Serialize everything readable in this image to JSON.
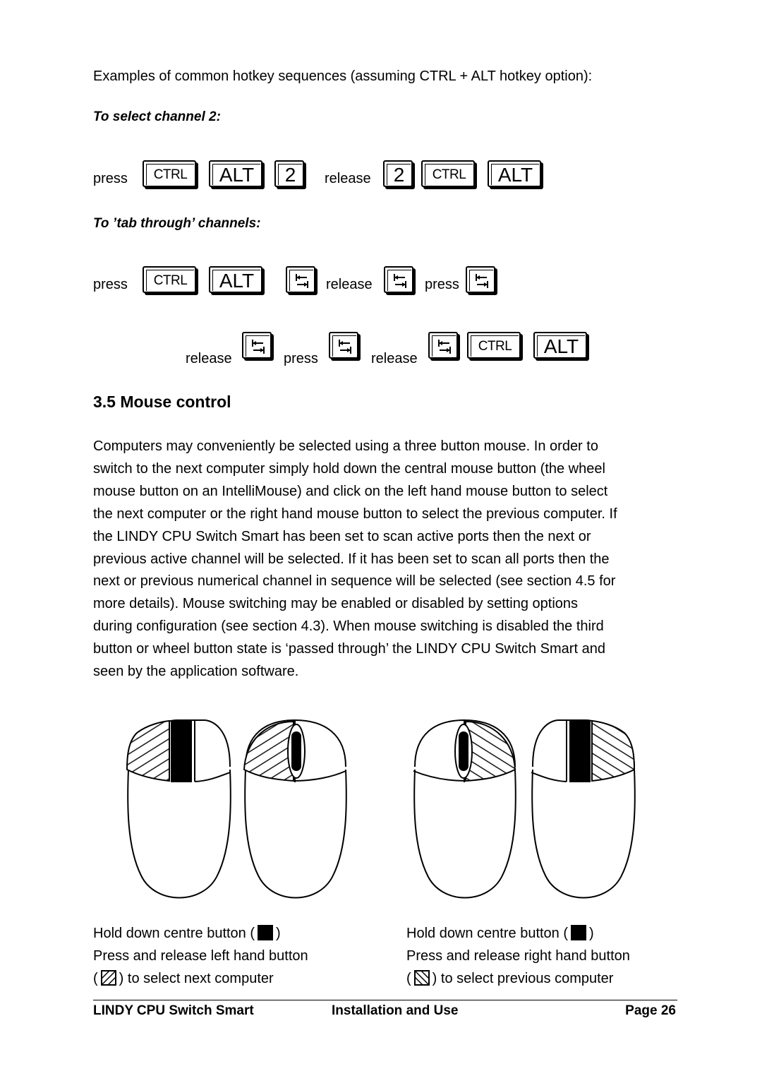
{
  "intro": "Examples of common hotkey sequences (assuming CTRL + ALT hotkey option):",
  "example1": {
    "heading": "To select channel 2:",
    "sequence": [
      {
        "type": "word",
        "text": "press"
      },
      {
        "type": "key",
        "key": "CTRL"
      },
      {
        "type": "key",
        "key": "ALT"
      },
      {
        "type": "key",
        "key": "2"
      },
      {
        "type": "word",
        "text": "release"
      },
      {
        "type": "key",
        "key": "2"
      },
      {
        "type": "key",
        "key": "CTRL"
      },
      {
        "type": "key",
        "key": "ALT"
      }
    ]
  },
  "example2": {
    "heading": "To ’tab through’ channels:",
    "sequence_line1": [
      {
        "type": "word",
        "text": "press"
      },
      {
        "type": "key",
        "key": "CTRL"
      },
      {
        "type": "key",
        "key": "ALT"
      },
      {
        "type": "key",
        "key": "TAB",
        "icon": "tab-key-icon"
      },
      {
        "type": "word",
        "text": "release"
      },
      {
        "type": "key",
        "key": "TAB",
        "icon": "tab-key-icon"
      },
      {
        "type": "word",
        "text": "press"
      },
      {
        "type": "key",
        "key": "TAB",
        "icon": "tab-key-icon"
      }
    ],
    "sequence_line2": [
      {
        "type": "word",
        "text": "release"
      },
      {
        "type": "key",
        "key": "TAB",
        "icon": "tab-key-icon"
      },
      {
        "type": "word",
        "text": "press"
      },
      {
        "type": "key",
        "key": "TAB",
        "icon": "tab-key-icon"
      },
      {
        "type": "word",
        "text": "release"
      },
      {
        "type": "key",
        "key": "TAB",
        "icon": "tab-key-icon"
      },
      {
        "type": "key",
        "key": "CTRL"
      },
      {
        "type": "key",
        "key": "ALT"
      }
    ]
  },
  "section": {
    "title": "3.5 Mouse control",
    "paragraph_lines": [
      "Computers may conveniently be selected using a three button mouse. In order to",
      "switch to the next computer simply hold down the central mouse button (the wheel",
      "mouse button on an IntelliMouse) and click on the left hand mouse button to select",
      "the next computer or the right hand mouse button to select the previous computer. If",
      "the LINDY CPU Switch Smart has been set to scan active ports then the next or",
      "previous active channel will be selected. If it has been set to scan all ports then the",
      "next or previous numerical channel in sequence will be selected (see section 4.5 for",
      "more details). Mouse switching may be enabled or disabled by setting options",
      "during configuration (see section 4.3). When mouse switching is disabled the third",
      "button or wheel button state is ‘passed through’ the LINDY CPU Switch Smart and",
      "seen by the application software."
    ]
  },
  "figures": {
    "mice": [
      {
        "name": "mouse-three-button-left-hatched",
        "style": "three-button",
        "hatched_side": "left"
      },
      {
        "name": "mouse-wheel-left-hatched",
        "style": "wheel",
        "hatched_side": "left"
      },
      {
        "name": "mouse-wheel-right-hatched",
        "style": "wheel",
        "hatched_side": "right"
      },
      {
        "name": "mouse-three-button-right-hatched",
        "style": "three-button",
        "hatched_side": "right"
      }
    ],
    "caption_left": {
      "line1_pre": "Hold down centre button (",
      "line1_post": ")",
      "line2": "Press and release left hand button",
      "line3_pre": "(",
      "line3_post": ") to select next computer"
    },
    "caption_right": {
      "line1_pre": "Hold down centre button (",
      "line1_post": ")",
      "line2": "Press and release right hand button",
      "line3_pre": "(",
      "line3_post": ") to select previous computer"
    }
  },
  "footer": {
    "left": "LINDY CPU Switch Smart",
    "center": "Installation and Use",
    "right": "Page 26"
  }
}
